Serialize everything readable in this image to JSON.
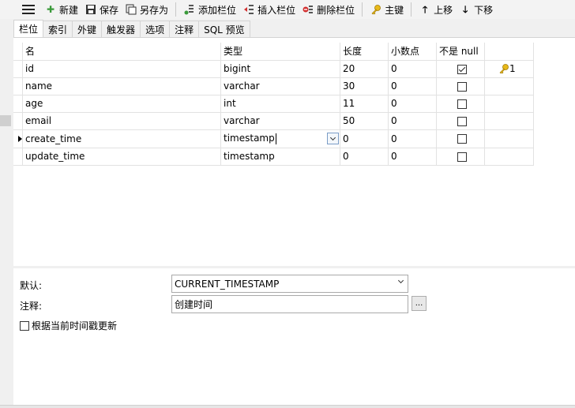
{
  "toolbar": {
    "new_label": "新建",
    "save_label": "保存",
    "save_as_label": "另存为",
    "add_field_label": "添加栏位",
    "insert_field_label": "插入栏位",
    "delete_field_label": "删除栏位",
    "primary_key_label": "主键",
    "move_up_label": "上移",
    "move_down_label": "下移"
  },
  "tabs": [
    {
      "label": "栏位",
      "active": true
    },
    {
      "label": "索引"
    },
    {
      "label": "外键"
    },
    {
      "label": "触发器"
    },
    {
      "label": "选项"
    },
    {
      "label": "注释"
    },
    {
      "label": "SQL 预览"
    }
  ],
  "grid": {
    "headers": {
      "name": "名",
      "type": "类型",
      "length": "长度",
      "decimals": "小数点",
      "not_null": "不是 null"
    },
    "rows": [
      {
        "name": "id",
        "type": "bigint",
        "length": "20",
        "decimals": "0",
        "not_null": true,
        "key": "1"
      },
      {
        "name": "name",
        "type": "varchar",
        "length": "30",
        "decimals": "0",
        "not_null": false,
        "key": ""
      },
      {
        "name": "age",
        "type": "int",
        "length": "11",
        "decimals": "0",
        "not_null": false,
        "key": ""
      },
      {
        "name": "email",
        "type": "varchar",
        "length": "50",
        "decimals": "0",
        "not_null": false,
        "key": ""
      },
      {
        "name": "create_time",
        "type": "timestamp",
        "length": "0",
        "decimals": "0",
        "not_null": false,
        "key": "",
        "selected": true
      },
      {
        "name": "update_time",
        "type": "timestamp",
        "length": "0",
        "decimals": "0",
        "not_null": false,
        "key": ""
      }
    ]
  },
  "props": {
    "default_label": "默认:",
    "default_value": "CURRENT_TIMESTAMP",
    "comment_label": "注释:",
    "comment_value": "创建时间",
    "ellipsis_label": "...",
    "on_update_label": "根据当前时间戳更新"
  },
  "colors": {
    "key_icon": "#e8b91a",
    "add_icon": "#3a9a3a",
    "delete_icon": "#d23030"
  }
}
